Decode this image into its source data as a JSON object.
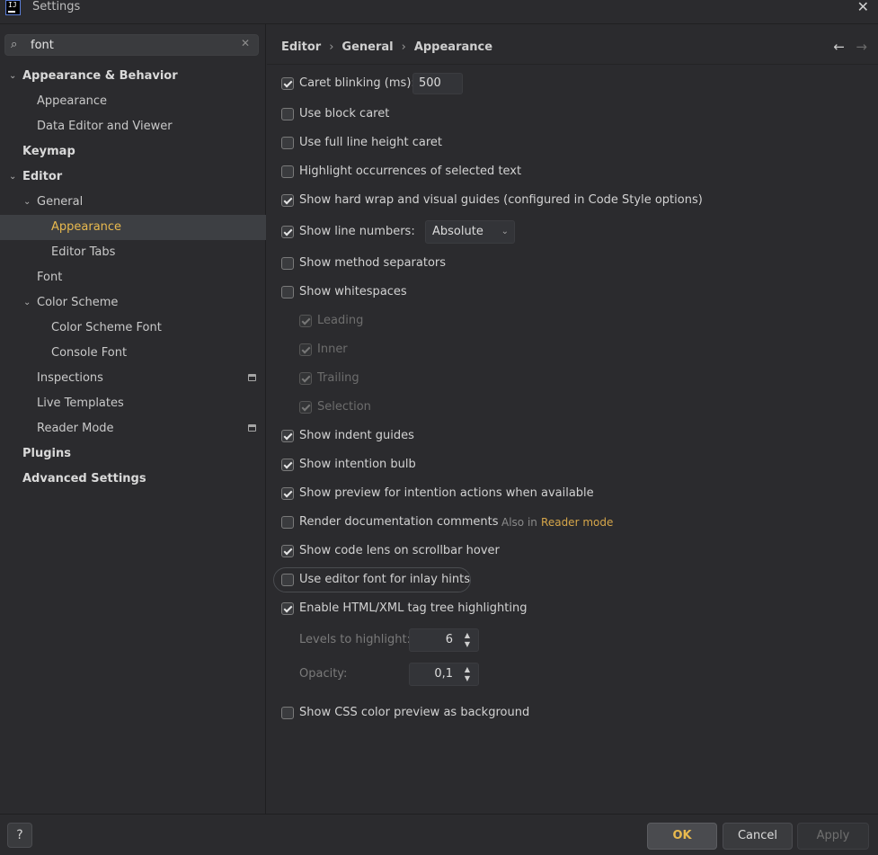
{
  "window": {
    "title": "Settings",
    "logo_text": "IJ",
    "close_glyph": "✕"
  },
  "sidebar": {
    "search": {
      "value": "font",
      "placeholder": ""
    },
    "tree": [
      {
        "label": "Appearance & Behavior",
        "level": 0,
        "expanded": true,
        "bold": true
      },
      {
        "label": "Appearance",
        "level": 1
      },
      {
        "label": "Data Editor and Viewer",
        "level": 1
      },
      {
        "label": "Keymap",
        "level": 0,
        "bold": true
      },
      {
        "label": "Editor",
        "level": 0,
        "expanded": true,
        "bold": true
      },
      {
        "label": "General",
        "level": 1,
        "expanded": true
      },
      {
        "label": "Appearance",
        "level": 2,
        "selected": true
      },
      {
        "label": "Editor Tabs",
        "level": 2
      },
      {
        "label": "Font",
        "level": 1
      },
      {
        "label": "Color Scheme",
        "level": 1,
        "expanded": true
      },
      {
        "label": "Color Scheme Font",
        "level": 2
      },
      {
        "label": "Console Font",
        "level": 2
      },
      {
        "label": "Inspections",
        "level": 1,
        "project_icon": true
      },
      {
        "label": "Live Templates",
        "level": 1
      },
      {
        "label": "Reader Mode",
        "level": 1,
        "project_icon": true
      },
      {
        "label": "Plugins",
        "level": 0,
        "bold": true
      },
      {
        "label": "Advanced Settings",
        "level": 0,
        "bold": true
      }
    ]
  },
  "breadcrumb": [
    "Editor",
    "General",
    "Appearance"
  ],
  "options": {
    "caret_blinking": {
      "label": "Caret blinking (ms):",
      "checked": true,
      "value": "500"
    },
    "block_caret": {
      "label": "Use block caret",
      "checked": false
    },
    "full_line_caret": {
      "label": "Use full line height caret",
      "checked": false
    },
    "highlight_occurrences": {
      "label": "Highlight occurrences of selected text",
      "checked": false
    },
    "hard_wrap": {
      "label": "Show hard wrap and visual guides (configured in Code Style options)",
      "checked": true
    },
    "line_numbers": {
      "label": "Show line numbers:",
      "checked": true,
      "value": "Absolute"
    },
    "method_separators": {
      "label": "Show method separators",
      "checked": false
    },
    "whitespaces": {
      "label": "Show whitespaces",
      "checked": false
    },
    "leading": {
      "label": "Leading",
      "checked": true
    },
    "inner": {
      "label": "Inner",
      "checked": true
    },
    "trailing": {
      "label": "Trailing",
      "checked": true
    },
    "selection": {
      "label": "Selection",
      "checked": true
    },
    "indent_guides": {
      "label": "Show indent guides",
      "checked": true
    },
    "intention_bulb": {
      "label": "Show intention bulb",
      "checked": true
    },
    "intention_preview": {
      "label": "Show preview for intention actions when available",
      "checked": true
    },
    "render_docs": {
      "label": "Render documentation comments",
      "checked": false,
      "also_prefix": "Also in",
      "also_link": "Reader mode"
    },
    "code_lens": {
      "label": "Show code lens on scrollbar hover",
      "checked": true
    },
    "editor_font_inlay": {
      "label": "Use editor font for inlay hints",
      "checked": false
    },
    "tag_tree": {
      "label": "Enable HTML/XML tag tree highlighting",
      "checked": true
    },
    "levels": {
      "label": "Levels to highlight:",
      "value": "6"
    },
    "opacity": {
      "label": "Opacity:",
      "value": "0,1"
    },
    "css_color": {
      "label": "Show CSS color preview as background",
      "checked": false
    }
  },
  "footer": {
    "help": "?",
    "ok": "OK",
    "cancel": "Cancel",
    "apply": "Apply"
  },
  "colors": {
    "background": "#2b2b2e",
    "accent": "#e8b94e",
    "link": "#d6a64a"
  }
}
